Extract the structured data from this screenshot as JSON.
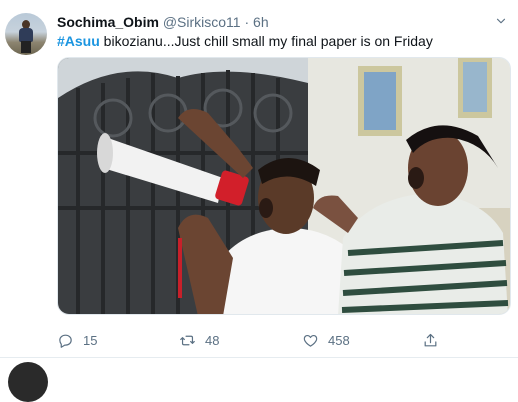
{
  "tweet": {
    "author_name": "Sochima_Obim",
    "handle": "@Sirkisco11",
    "separator": "·",
    "time": "6h",
    "hashtag": "#Asuu",
    "body_text": " bikozianu...Just chill small my final paper is on Friday",
    "media": {
      "icon": "photo"
    },
    "actions": {
      "reply_count": "15",
      "retweet_count": "48",
      "like_count": "458"
    }
  },
  "icons": {
    "caret": "chevron-down-icon",
    "reply": "reply-icon",
    "retweet": "retweet-icon",
    "like": "heart-icon",
    "share": "share-icon"
  },
  "colors": {
    "hashtag": "#1b95e0",
    "muted": "#5b7083",
    "divider": "#e6ecf0"
  }
}
